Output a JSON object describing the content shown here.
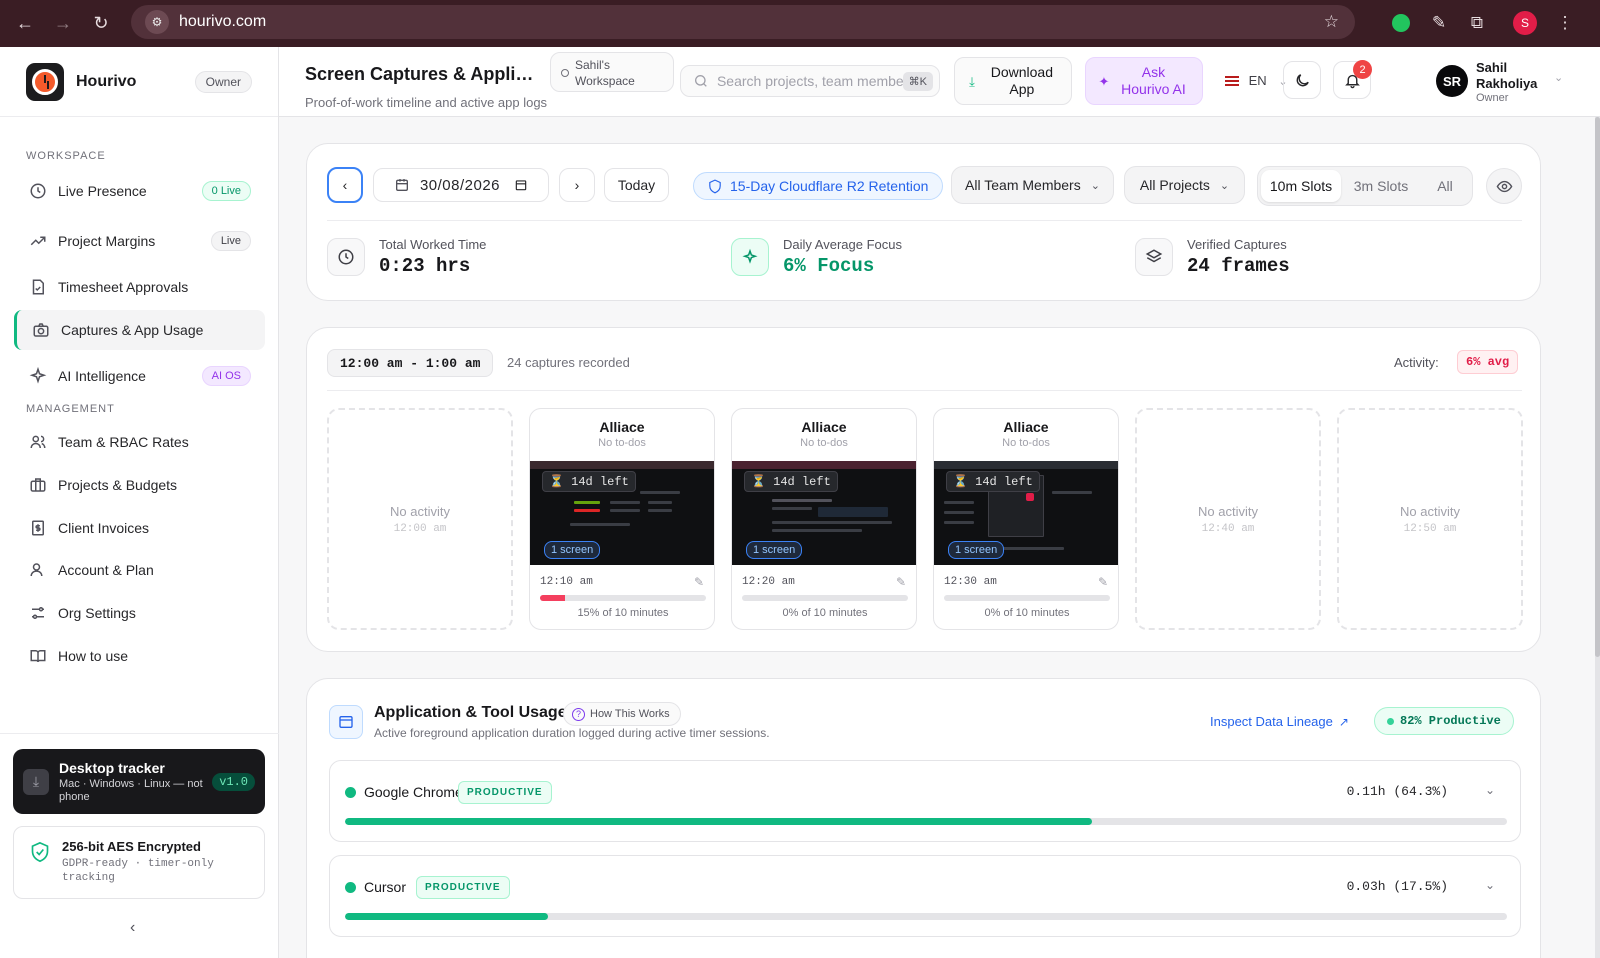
{
  "browser": {
    "url": "hourivo.com",
    "profile_initial": "S"
  },
  "brand": {
    "name": "Hourivo",
    "role": "Owner"
  },
  "sidebar": {
    "workspace_label": "WORKSPACE",
    "management_label": "MANAGEMENT",
    "items": [
      {
        "label": "Live Presence",
        "badge": "0 Live",
        "icon": "clock-icon"
      },
      {
        "label": "Project Margins",
        "badge": "Live",
        "icon": "trend-icon"
      },
      {
        "label": "Timesheet Approvals",
        "badge": "",
        "icon": "document-check-icon"
      },
      {
        "label": "Captures & App Usage",
        "badge": "",
        "icon": "camera-icon"
      },
      {
        "label": "AI Intelligence",
        "badge": "AI OS",
        "icon": "sparkle-icon"
      },
      {
        "label": "Team & RBAC Rates",
        "badge": "",
        "icon": "users-icon"
      },
      {
        "label": "Projects & Budgets",
        "badge": "",
        "icon": "briefcase-icon"
      },
      {
        "label": "Client Invoices",
        "badge": "",
        "icon": "invoice-icon"
      },
      {
        "label": "Account & Plan",
        "badge": "",
        "icon": "user-icon"
      },
      {
        "label": "Org Settings",
        "badge": "",
        "icon": "sliders-icon"
      },
      {
        "label": "How to use",
        "badge": "",
        "icon": "book-icon"
      }
    ],
    "tracker": {
      "title": "Desktop tracker",
      "subtitle": "Mac · Windows · Linux — not phone",
      "version": "v1.0"
    },
    "security": {
      "title": "256-bit AES Encrypted",
      "subtitle": "GDPR-ready · timer-only tracking"
    }
  },
  "header": {
    "title": "Screen Captures & Applica...",
    "subtitle": "Proof-of-work timeline and active app logs",
    "workspace": "Sahil's Workspace",
    "search_placeholder": "Search projects, team membe",
    "search_shortcut": "⌘K",
    "download_label": "Download App",
    "ask_ai_label": "Ask Hourivo AI",
    "language": "EN",
    "notification_count": "2",
    "user_initials": "SR",
    "user_name": "Sahil Rakholiya",
    "user_role": "Owner"
  },
  "filters": {
    "date": "30/08/2026",
    "today_label": "Today",
    "retention": "15-Day Cloudflare R2 Retention",
    "team": "All Team Members",
    "projects": "All Projects",
    "slot_options": [
      "10m Slots",
      "3m Slots",
      "All"
    ],
    "selected_slot": "10m Slots"
  },
  "stats": [
    {
      "label": "Total Worked Time",
      "value": "0:23 hrs",
      "icon": "clock-icon"
    },
    {
      "label": "Daily Average Focus",
      "value": "6% Focus",
      "icon": "sparkle-icon"
    },
    {
      "label": "Verified Captures",
      "value": "24 frames",
      "icon": "layers-icon"
    }
  ],
  "timeline": {
    "range": "12:00 am - 1:00 am",
    "captures": "24 captures recorded",
    "activity_label": "Activity:",
    "activity_avg": "6% avg",
    "slots": [
      {
        "type": "empty",
        "label": "No activity",
        "time": "12:00 am"
      },
      {
        "type": "capture",
        "project": "Alliace",
        "todo": "No to-dos",
        "badge": "14d left",
        "screens": "1 screen",
        "time": "12:10 am",
        "progress": 0.15,
        "progress_text": "15% of 10 minutes"
      },
      {
        "type": "capture",
        "project": "Alliace",
        "todo": "No to-dos",
        "badge": "14d left",
        "screens": "1 screen",
        "time": "12:20 am",
        "progress": 0,
        "progress_text": "0% of 10 minutes"
      },
      {
        "type": "capture",
        "project": "Alliace",
        "todo": "No to-dos",
        "badge": "14d left",
        "screens": "1 screen",
        "time": "12:30 am",
        "progress": 0,
        "progress_text": "0% of 10 minutes"
      },
      {
        "type": "empty",
        "label": "No activity",
        "time": "12:40 am"
      },
      {
        "type": "empty",
        "label": "No activity",
        "time": "12:50 am"
      }
    ]
  },
  "usage": {
    "title": "Application & Tool Usage",
    "how_label": "How This Works",
    "subtitle": "Active foreground application duration logged during active timer sessions.",
    "lineage_link": "Inspect Data Lineage",
    "productive_badge": "82% Productive",
    "apps": [
      {
        "name": "Google Chrome",
        "tag": "PRODUCTIVE",
        "value": "0.11h (64.3%)",
        "share": 0.643
      },
      {
        "name": "Cursor",
        "tag": "PRODUCTIVE",
        "value": "0.03h (17.5%)",
        "share": 0.175
      }
    ]
  },
  "colors": {
    "accent_green": "#10b981",
    "accent_purple": "#9333ea",
    "accent_blue": "#2563eb",
    "danger": "#f43f5e",
    "browser_chrome": "#3a1d24"
  }
}
